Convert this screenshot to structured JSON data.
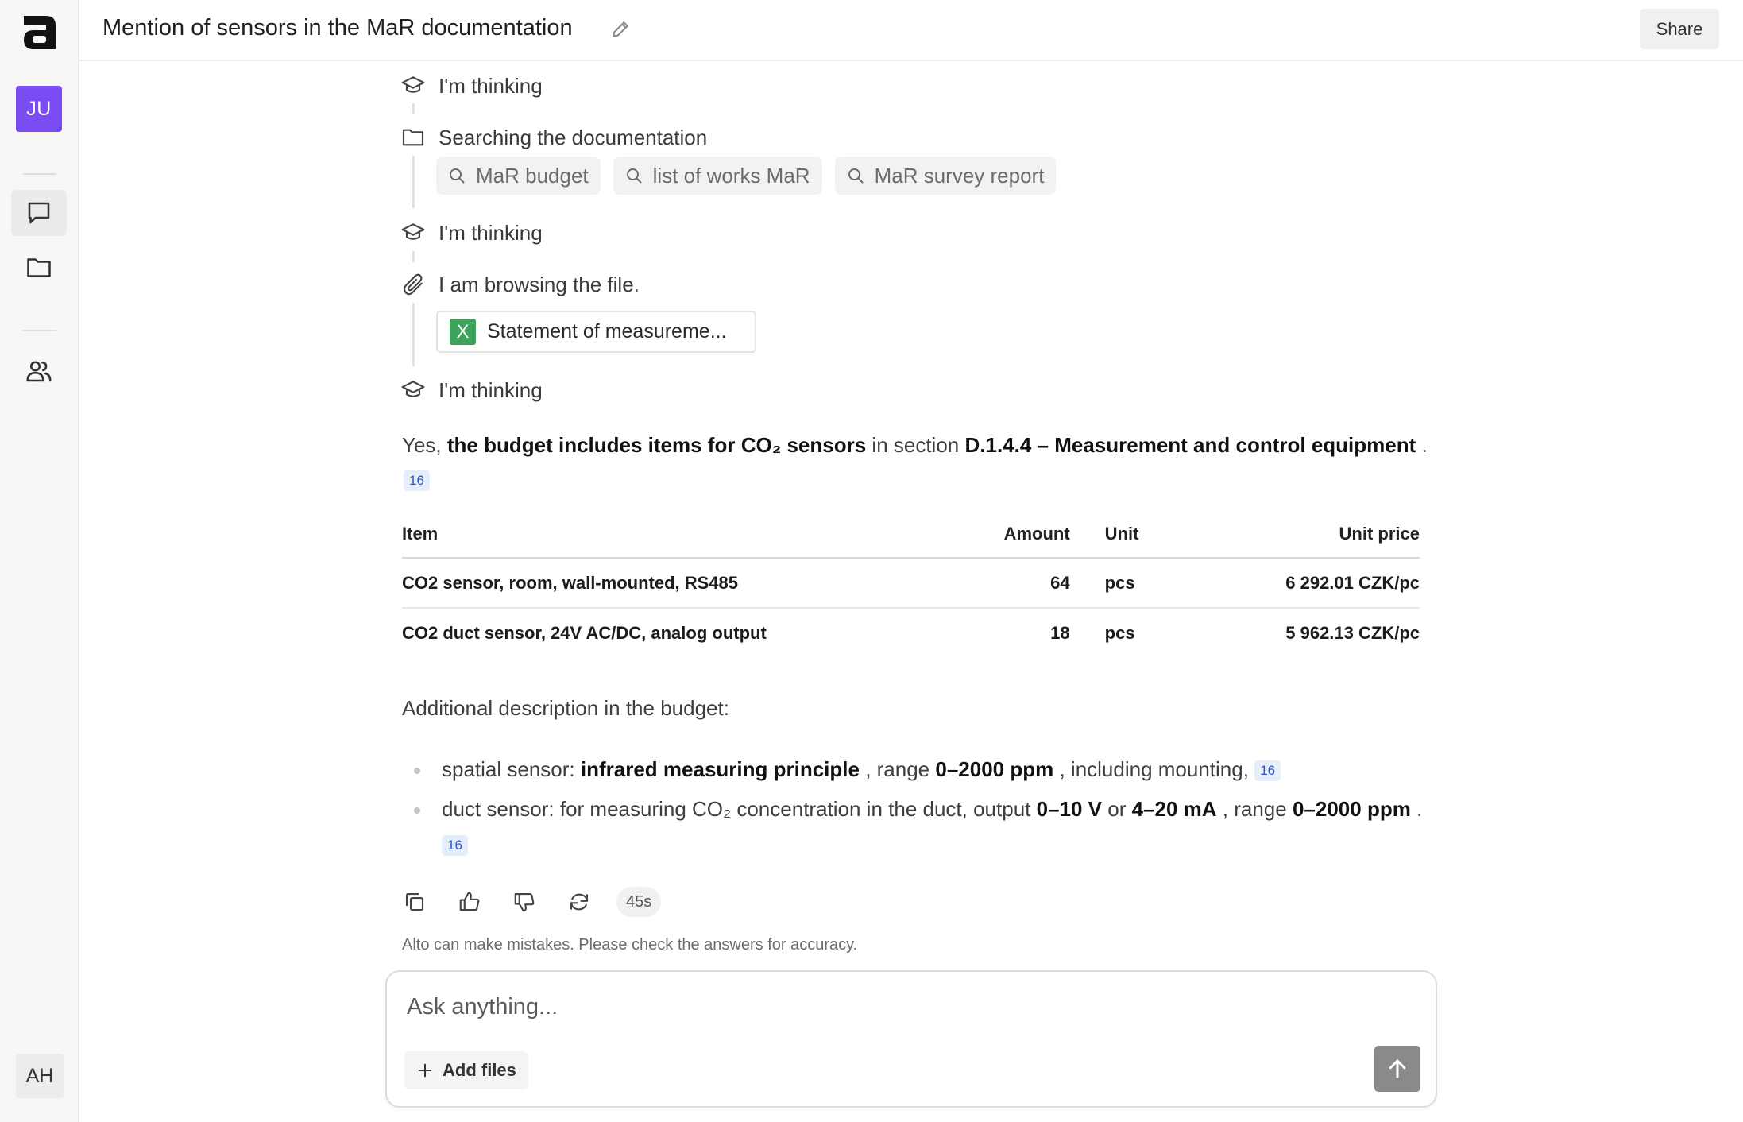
{
  "sidebar": {
    "user_initials": "JU",
    "bottom_initials": "AH",
    "items": [
      {
        "name": "chats",
        "icon": "chat-bubble-icon",
        "active": true
      },
      {
        "name": "files",
        "icon": "folder-icon",
        "active": false
      },
      {
        "name": "team",
        "icon": "users-icon",
        "active": false
      }
    ]
  },
  "header": {
    "title": "Mention of sensors in the MaR documentation",
    "share_label": "Share"
  },
  "steps": {
    "thinking_1": "I'm thinking",
    "searching": "Searching the documentation",
    "queries": [
      "MaR budget",
      "list of works MaR",
      "MaR survey report"
    ],
    "thinking_2": "I'm thinking",
    "browsing": "I am browsing the file.",
    "file_name": "Statement of measureme...",
    "file_icon_letter": "X",
    "thinking_3": "I'm thinking"
  },
  "answer": {
    "intro_yes": "Yes, ",
    "intro_bold": "the budget includes items for CO₂ sensors",
    "intro_mid": " in section ",
    "intro_section": "D.1.4.4 – Measurement and control equipment",
    "intro_end": " .",
    "citation": "16"
  },
  "table": {
    "headers": [
      "Item",
      "Amount",
      "Unit",
      "Unit price"
    ],
    "rows": [
      [
        "CO2 sensor, room, wall-mounted, RS485",
        "64",
        "pcs",
        "6 292.01 CZK/pc"
      ],
      [
        "CO2 duct sensor, 24V AC/DC, analog output",
        "18",
        "pcs",
        "5 962.13 CZK/pc"
      ]
    ]
  },
  "additional": {
    "heading": "Additional description in the budget:",
    "b1": {
      "pre": "spatial sensor: ",
      "bold1": "infrared measuring principle",
      "mid": " , range ",
      "bold2": "0–2000 ppm",
      "post": " , including mounting, ",
      "cite": "16"
    },
    "b2": {
      "pre": "duct sensor: for measuring CO₂ concentration in the duct, output ",
      "bold1": "0–10 V",
      "or": " or ",
      "bold2": "4–20 mA",
      "mid": " , range ",
      "bold3": "0–2000 ppm",
      "post": " . ",
      "cite": "16"
    }
  },
  "actions": {
    "time": "45s",
    "disclaimer": "Alto can make mistakes. Please check the answers for accuracy."
  },
  "composer": {
    "placeholder": "Ask anything...",
    "add_files_label": "Add files"
  }
}
